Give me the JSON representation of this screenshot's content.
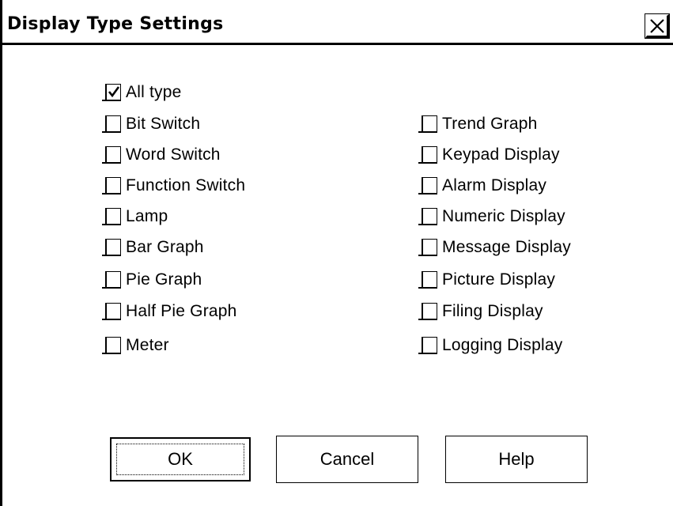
{
  "dialog": {
    "title": "Display Type Settings"
  },
  "checkboxes_left": [
    {
      "label": "All type",
      "checked": true
    },
    {
      "label": "Bit Switch",
      "checked": false
    },
    {
      "label": "Word Switch",
      "checked": false
    },
    {
      "label": "Function Switch",
      "checked": false
    },
    {
      "label": "Lamp",
      "checked": false
    },
    {
      "label": "Bar Graph",
      "checked": false
    },
    {
      "label": "Pie Graph",
      "checked": false
    },
    {
      "label": "Half Pie Graph",
      "checked": false
    },
    {
      "label": "Meter",
      "checked": false
    }
  ],
  "checkboxes_right": [
    {
      "label": "Trend Graph",
      "checked": false
    },
    {
      "label": "Keypad Display",
      "checked": false
    },
    {
      "label": "Alarm Display",
      "checked": false
    },
    {
      "label": "Numeric Display",
      "checked": false
    },
    {
      "label": "Message Display",
      "checked": false
    },
    {
      "label": "Picture Display",
      "checked": false
    },
    {
      "label": "Filing Display",
      "checked": false
    },
    {
      "label": "Logging Display",
      "checked": false
    }
  ],
  "buttons": {
    "ok": "OK",
    "cancel": "Cancel",
    "help": "Help"
  }
}
